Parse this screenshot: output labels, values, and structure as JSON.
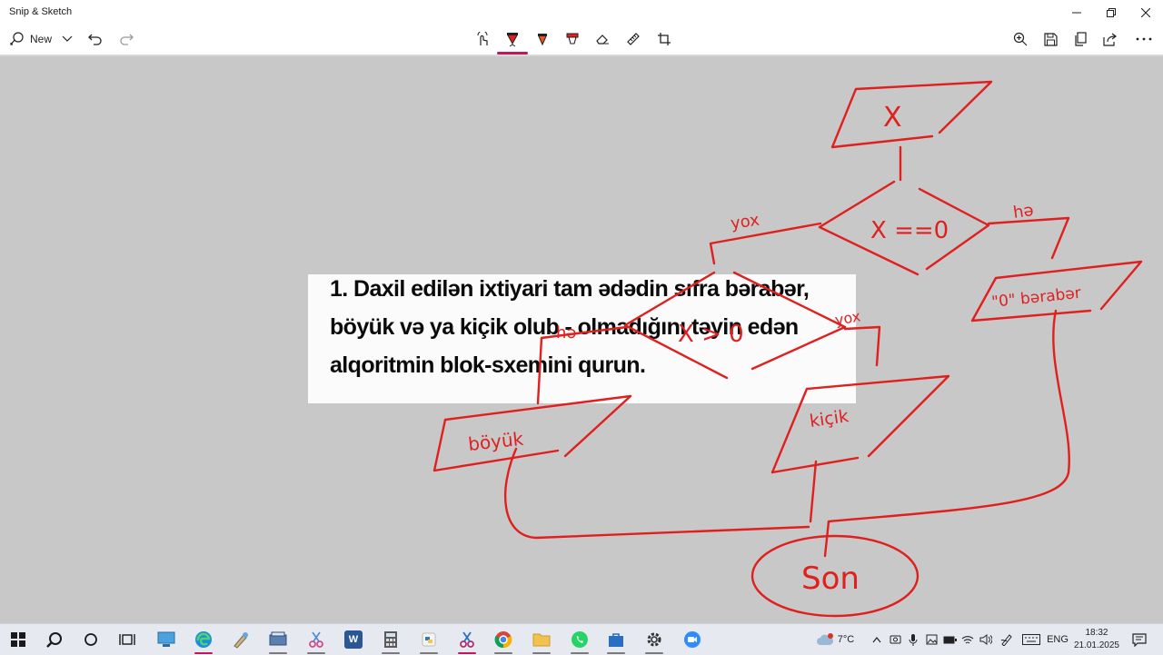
{
  "window": {
    "title": "Snip & Sketch"
  },
  "toolbar": {
    "new_label": "New",
    "icons": [
      "touch-writing-icon",
      "ballpoint-pen-icon",
      "pencil-icon",
      "highlighter-icon",
      "eraser-icon",
      "ruler-icon",
      "crop-icon",
      "zoom-icon",
      "save-icon",
      "copy-icon",
      "share-icon",
      "more-icon"
    ],
    "pen_color": "#c2185b"
  },
  "document": {
    "lines": [
      "1. Daxil edilən ixtiyari tam ədədin sıfra bərabər,",
      "böyük və ya kiçik olub - olmadığını təyin edən",
      "alqoritmin blok-sxemini qurun."
    ]
  },
  "annotations": {
    "ink_color": "#e01f1f",
    "input": "X",
    "condition1": "X ==0",
    "yes1": "hə",
    "no1": "yox",
    "zero_output": "\"0\" bərabər",
    "condition2": "X > 0",
    "yes2": "hə",
    "no2": "yox",
    "greater_output": "böyük",
    "less_output": "kiçik",
    "end": "Son"
  },
  "taskbar": {
    "apps": [
      "start",
      "search",
      "cortana",
      "task-view",
      "remote-desktop",
      "edge",
      "paint",
      "scanner",
      "snip-tool",
      "word",
      "calculator",
      "python",
      "snip-sketch",
      "chrome",
      "file-explorer",
      "whatsapp",
      "store",
      "settings",
      "zoom"
    ],
    "weather": {
      "temp": "7°C",
      "badge": "1"
    },
    "language": "ENG",
    "time": "18:32",
    "date": "21.01.2025"
  }
}
